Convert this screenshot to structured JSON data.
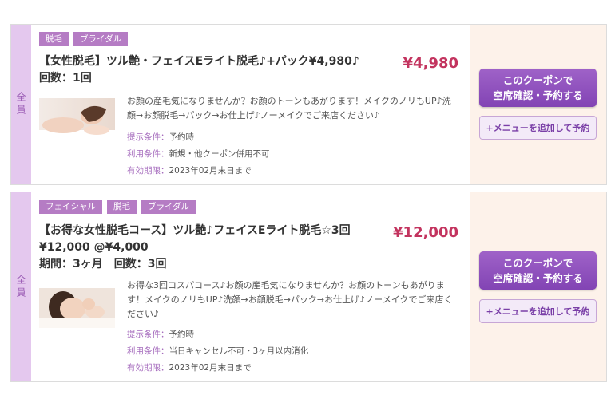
{
  "coupons": [
    {
      "side_label": "全員",
      "tags": [
        "脱毛",
        "ブライダル"
      ],
      "title_line1": "【女性脱毛】ツル艶・フェイスEライト脱毛♪+パック¥4,980♪",
      "title_line2": "回数：1回",
      "price": "¥4,980",
      "description": "お顔の産毛気になりませんか？お顔のトーンもあがります！メイクのノリもUP♪洗顔→お顔脱毛→パック→お仕上げ♪ノーメイクでご来店ください♪",
      "conditions": [
        {
          "label": "提示条件：",
          "value": "予約時"
        },
        {
          "label": "利用条件：",
          "value": "新規・他クーポン併用不可"
        },
        {
          "label": "有効期限：",
          "value": "2023年02月末日まで"
        }
      ],
      "book_button": {
        "line1": "このクーポンで",
        "line2": "空席確認・予約する"
      },
      "add_button": "+メニューを追加して予約"
    },
    {
      "side_label": "全員",
      "tags": [
        "フェイシャル",
        "脱毛",
        "ブライダル"
      ],
      "title_line1": "【お得な女性脱毛コース】ツル艶♪フェイスEライト脱毛☆3回",
      "title_line2": "¥12,000 @¥4,000",
      "title_line3": "期間：3ヶ月　回数：3回",
      "price": "¥12,000",
      "description": "お得な3回コスパコース♪お顔の産毛気になりませんか？お顔のトーンもあがります！メイクのノリもUP♪洗顔→お顔脱毛→パック→お仕上げ♪ノーメイクでご来店ください♪",
      "conditions": [
        {
          "label": "提示条件：",
          "value": "予約時"
        },
        {
          "label": "利用条件：",
          "value": "当日キャンセル不可・3ヶ月以内消化"
        },
        {
          "label": "有効期限：",
          "value": "2023年02月末日まで"
        }
      ],
      "book_button": {
        "line1": "このクーポンで",
        "line2": "空席確認・予約する"
      },
      "add_button": "+メニューを追加して予約"
    }
  ],
  "colors": {
    "accent": "#8a4bb8",
    "price": "#c3345f",
    "tag": "#b57cc4",
    "side": "#e4c8ee",
    "action_bg": "#fdf2ea"
  }
}
